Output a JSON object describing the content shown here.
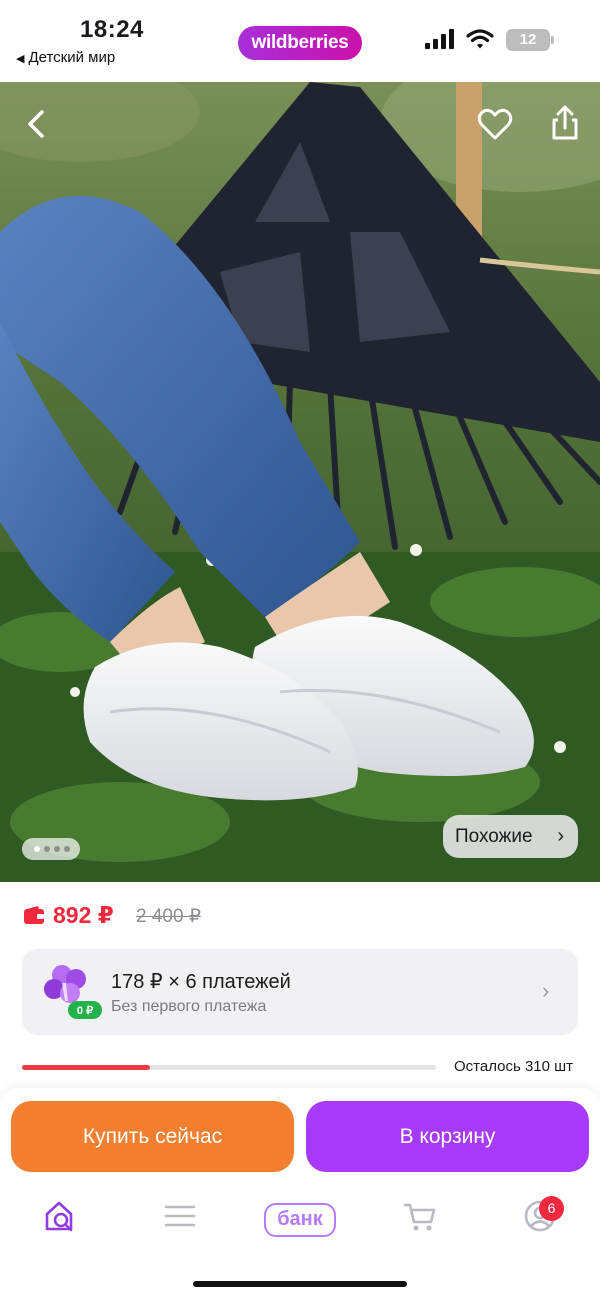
{
  "status_bar": {
    "time": "18:24",
    "back_app": "Детский мир",
    "brand": "wildberries",
    "battery": "12"
  },
  "product": {
    "price": "892 ₽",
    "old_price": "2 400 ₽",
    "similar_label": "Похожие",
    "photo_count_dots": 4,
    "photo_active_index": 0
  },
  "installment": {
    "title": "178 ₽ × 6 платежей",
    "subtitle": "Без первого платежа",
    "badge": "0 ₽"
  },
  "stock": {
    "label": "Осталось 310 шт",
    "fill_fraction": 0.31
  },
  "actions": {
    "buy_now": "Купить сейчас",
    "add_to_cart": "В корзину"
  },
  "tabbar": {
    "items": [
      "home-search",
      "catalog",
      "bank",
      "cart",
      "profile"
    ],
    "bank_label": "банк",
    "profile_badge": "6"
  },
  "colors": {
    "brand_gradient_start": "#a72fd8",
    "brand_gradient_end": "#cb11ab",
    "price_red": "#f0293f",
    "buy_orange": "#f27e30",
    "cart_purple": "#a73afd",
    "bank_lilac": "#b67cff"
  }
}
